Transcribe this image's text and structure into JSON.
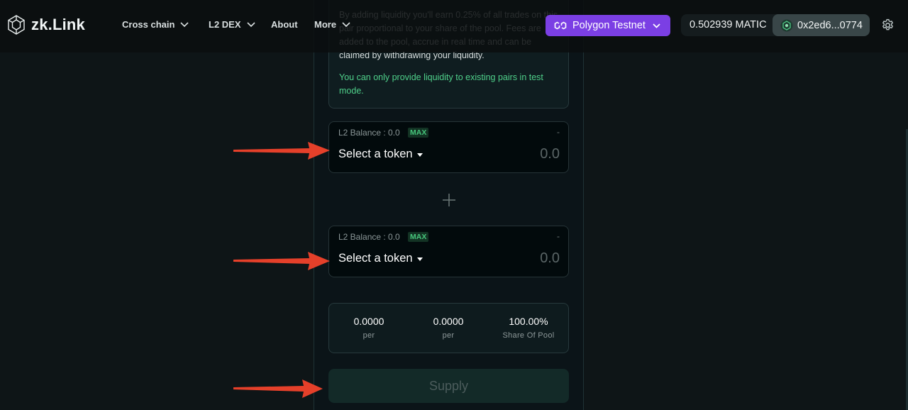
{
  "header": {
    "logo_text": "zk.Link",
    "nav": [
      {
        "label": "Cross chain",
        "has_dropdown": true
      },
      {
        "label": "L2 DEX",
        "has_dropdown": true
      },
      {
        "label": "About",
        "has_dropdown": false
      },
      {
        "label": "More",
        "has_dropdown": true
      }
    ],
    "network": "Polygon Testnet",
    "balance": "0.502939 MATIC",
    "address": "0x2ed6...0774",
    "colors": {
      "network_bg": "#7b3fe4",
      "address_bg": "#394648"
    }
  },
  "info": {
    "text": "By adding liquidity you'll earn 0.25% of all trades on this pair proportional to your share of the pool. Fees are added to the pool, accrue in real time and can be claimed by withdrawing your liquidity.",
    "note": "You can only provide liquidity to existing pairs in test mode."
  },
  "inputs": [
    {
      "balance_label": "L2 Balance : 0.0",
      "max_label": "MAX",
      "right_label": "-",
      "select_label": "Select a token",
      "amount_placeholder": "0.0"
    },
    {
      "balance_label": "L2 Balance : 0.0",
      "max_label": "MAX",
      "right_label": "-",
      "select_label": "Select a token",
      "amount_placeholder": "0.0"
    }
  ],
  "pool": [
    {
      "value": "0.0000",
      "label": "per"
    },
    {
      "value": "0.0000",
      "label": "per"
    },
    {
      "value": "100.00%",
      "label": "Share Of Pool"
    }
  ],
  "supply_label": "Supply",
  "annotation_color": "#e5402a"
}
